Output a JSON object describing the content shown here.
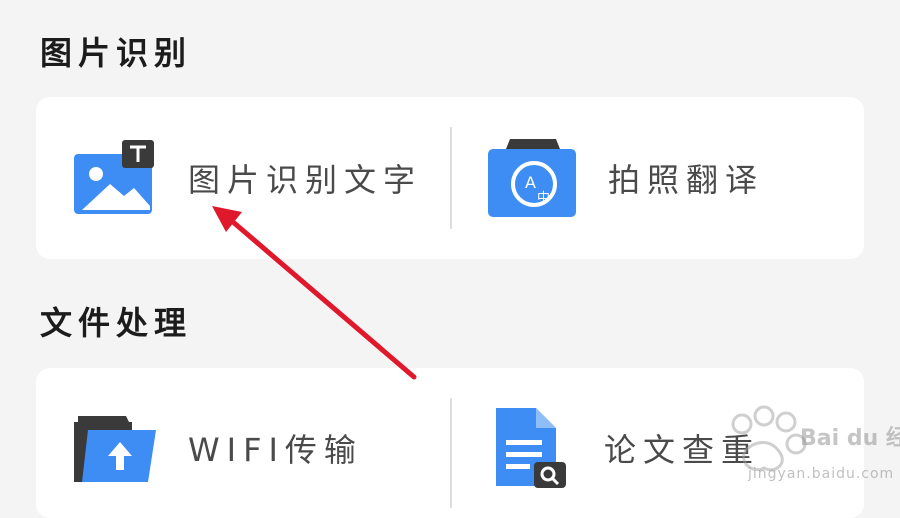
{
  "sections": [
    {
      "title": "图片识别",
      "items": [
        {
          "label": "图片识别文字",
          "icon": "image-text-icon"
        },
        {
          "label": "拍照翻译",
          "icon": "camera-translate-icon"
        }
      ]
    },
    {
      "title": "文件处理",
      "items": [
        {
          "label": "WIFI传输",
          "icon": "wifi-transfer-folder-icon"
        },
        {
          "label": "论文查重",
          "icon": "document-search-icon"
        }
      ]
    }
  ],
  "watermark": {
    "brand": "Bai du 经验",
    "url": "jingyan.baidu.com"
  },
  "colors": {
    "accent_blue": "#3d8df4",
    "dark_gray": "#3a3a3a",
    "arrow_red": "#e0182b"
  }
}
